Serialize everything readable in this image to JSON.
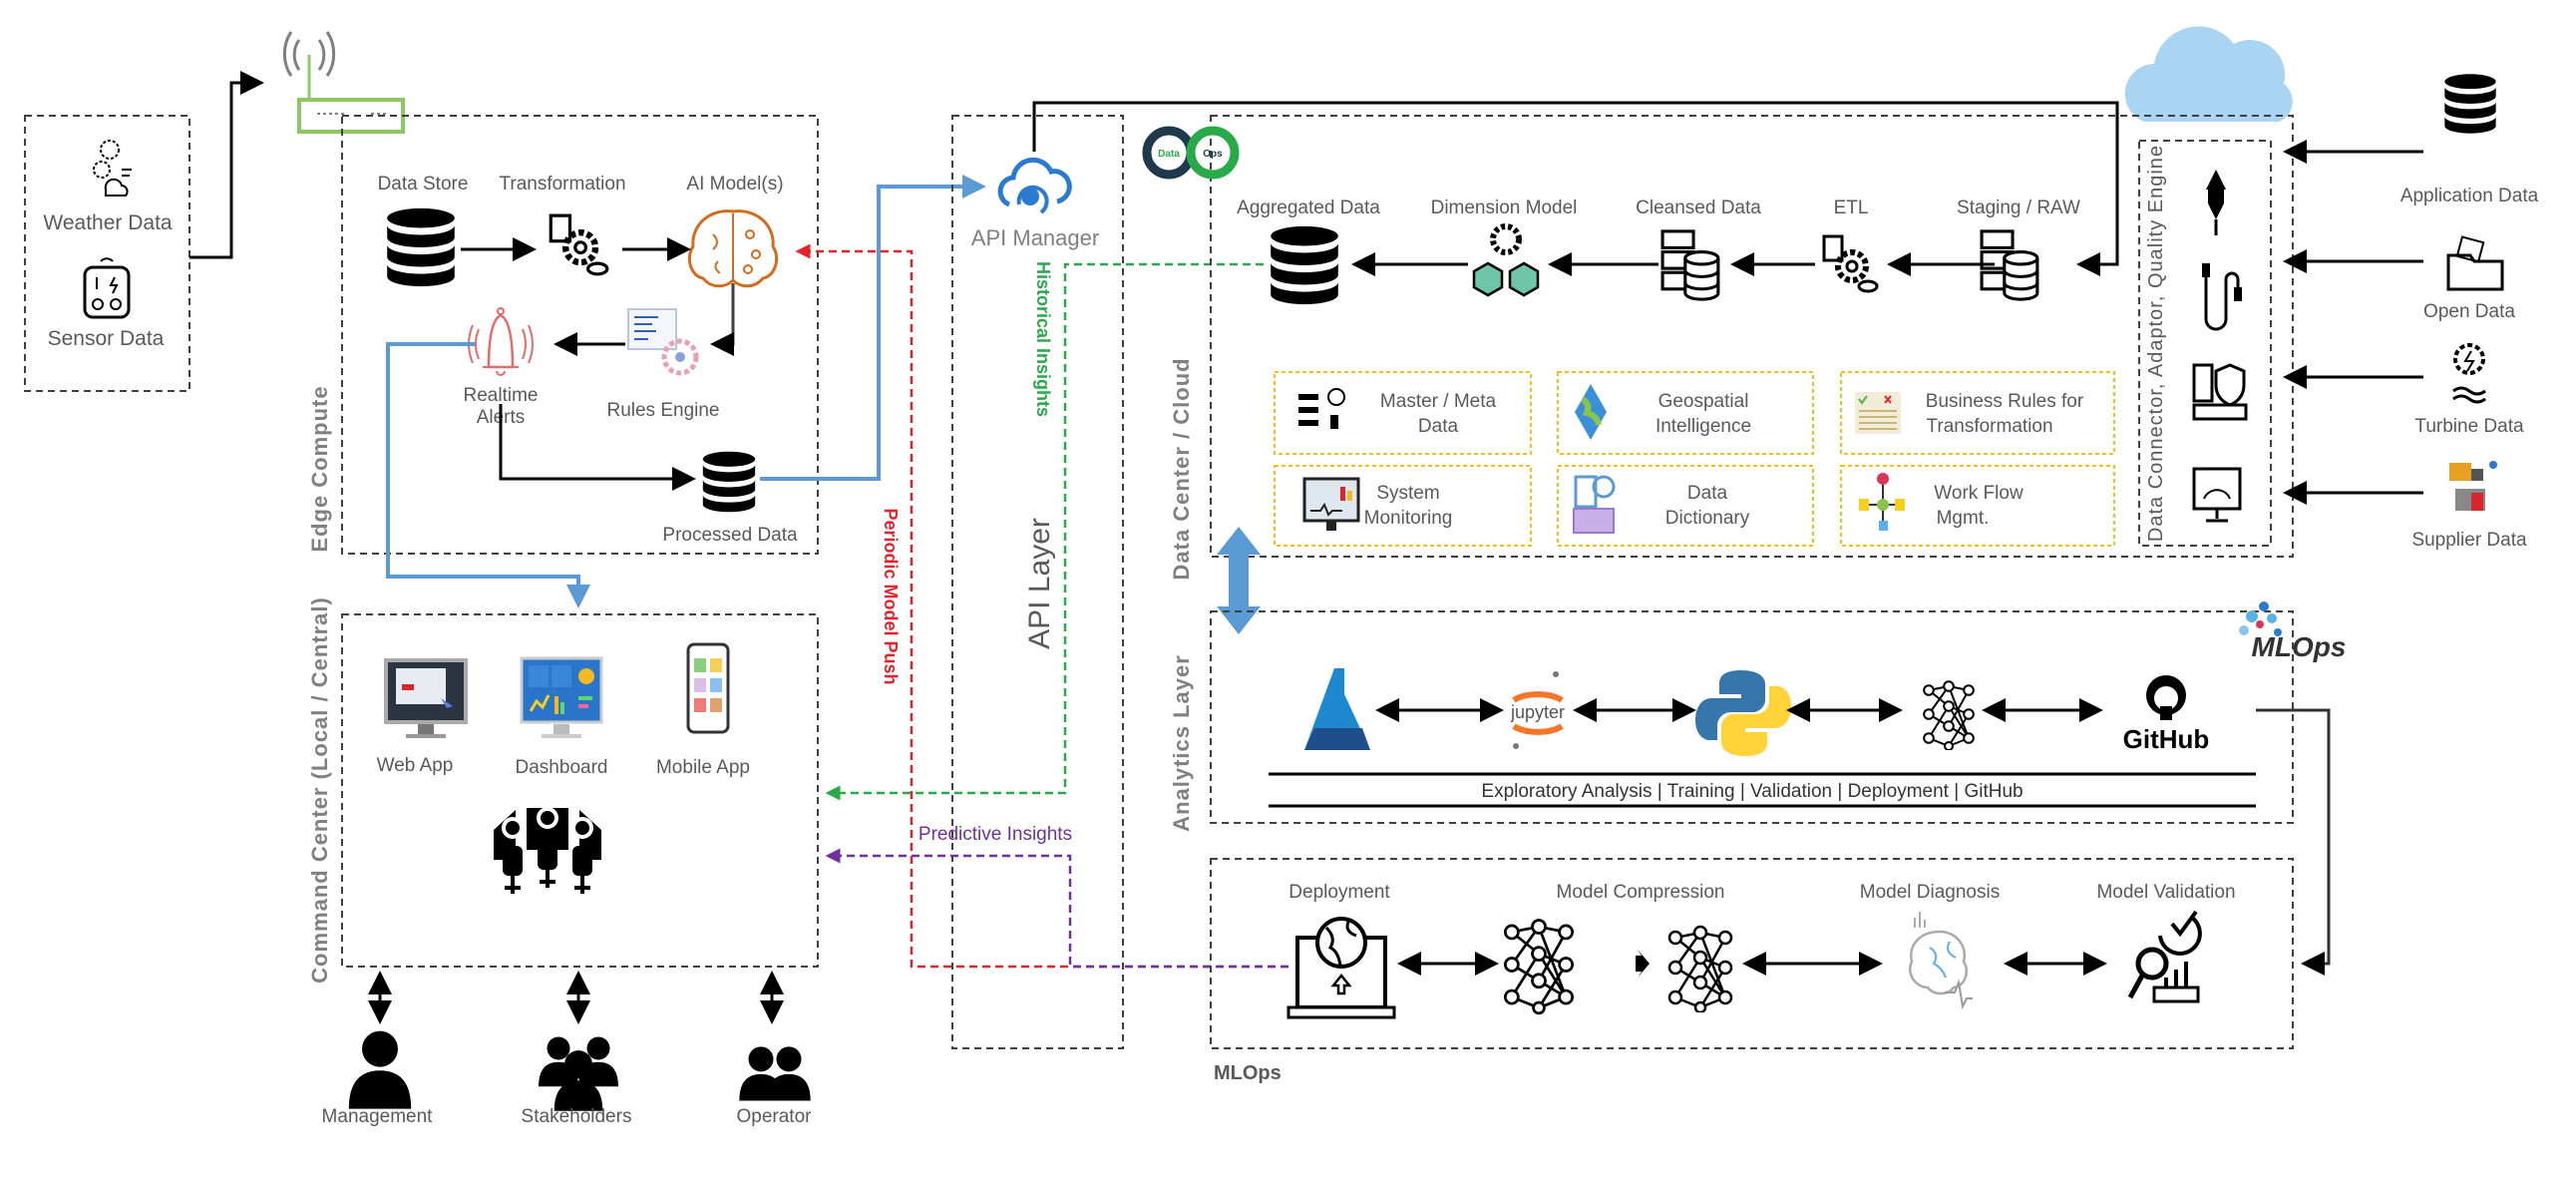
{
  "sources": {
    "weather": "Weather Data",
    "sensor": "Sensor Data"
  },
  "edge": {
    "title": "Edge Compute",
    "data_store": "Data Store",
    "transformation": "Transformation",
    "ai_models": "AI Model(s)",
    "realtime_alerts_1": "Realtime",
    "realtime_alerts_2": "Alerts",
    "rules_engine": "Rules Engine",
    "processed_data": "Processed Data"
  },
  "command_center": {
    "title": "Command Center (Local / Central)",
    "web_app": "Web App",
    "dashboard": "Dashboard",
    "mobile_app": "Mobile App"
  },
  "users": {
    "management": "Management",
    "stakeholders": "Stakeholders",
    "operator": "Operator"
  },
  "api_layer": {
    "title": "API Layer",
    "api_manager": "API Manager"
  },
  "flows": {
    "historical_insights": "Historical Insights",
    "periodic_model_push": "Periodic Model Push",
    "predictive_insights": "Predictive Insights"
  },
  "data_center": {
    "title": "Data Center / Cloud",
    "logo": {
      "left": "Data",
      "right": "Ops"
    },
    "pipeline": [
      "Aggregated Data",
      "Dimension Model",
      "Cleansed Data",
      "ETL",
      "Staging / RAW"
    ],
    "tiles": [
      {
        "line1": "Master / Meta",
        "line2": "Data"
      },
      {
        "line1": "Geospatial",
        "line2": "Intelligence"
      },
      {
        "line1": "Business Rules for",
        "line2": "Transformation"
      },
      {
        "line1": "System",
        "line2": "Monitoring"
      },
      {
        "line1": "Data",
        "line2": "Dictionary"
      },
      {
        "line1": "Work Flow",
        "line2": "Mgmt."
      }
    ],
    "connector_title": "Data Connector, Adaptor, Quality Engine"
  },
  "external_sources": [
    "Application Data",
    "Open Data",
    "Turbine Data",
    "Supplier Data"
  ],
  "analytics": {
    "title": "Analytics Layer",
    "logo": "MLOps",
    "jupyter": "jupyter",
    "github": "GitHub",
    "caption": "Exploratory Analysis | Training | Validation | Deployment | GitHub"
  },
  "mlops": {
    "title": "MLOps",
    "steps": [
      "Deployment",
      "Model Compression",
      "Model Diagnosis",
      "Model Validation"
    ]
  },
  "colors": {
    "blue": "#5b9bd5",
    "red": "#e8202a",
    "green": "#2aa94a",
    "purple": "#7030a0",
    "tile_border": "#f2c01e",
    "router": "#8fc862"
  }
}
